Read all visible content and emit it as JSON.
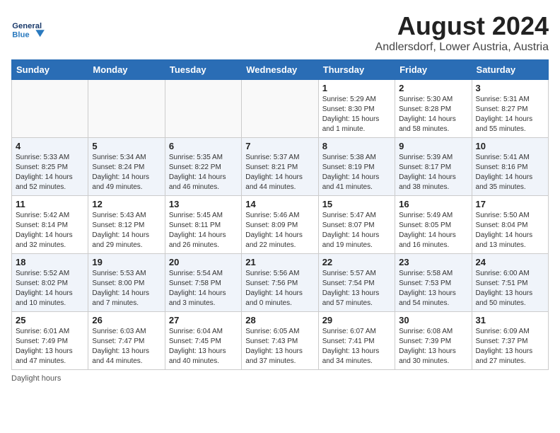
{
  "header": {
    "logo_general": "General",
    "logo_blue": "Blue",
    "month_title": "August 2024",
    "location": "Andlersdorf, Lower Austria, Austria"
  },
  "weekdays": [
    "Sunday",
    "Monday",
    "Tuesday",
    "Wednesday",
    "Thursday",
    "Friday",
    "Saturday"
  ],
  "weeks": [
    [
      {
        "day": "",
        "info": ""
      },
      {
        "day": "",
        "info": ""
      },
      {
        "day": "",
        "info": ""
      },
      {
        "day": "",
        "info": ""
      },
      {
        "day": "1",
        "info": "Sunrise: 5:29 AM\nSunset: 8:30 PM\nDaylight: 15 hours\nand 1 minute."
      },
      {
        "day": "2",
        "info": "Sunrise: 5:30 AM\nSunset: 8:28 PM\nDaylight: 14 hours\nand 58 minutes."
      },
      {
        "day": "3",
        "info": "Sunrise: 5:31 AM\nSunset: 8:27 PM\nDaylight: 14 hours\nand 55 minutes."
      }
    ],
    [
      {
        "day": "4",
        "info": "Sunrise: 5:33 AM\nSunset: 8:25 PM\nDaylight: 14 hours\nand 52 minutes."
      },
      {
        "day": "5",
        "info": "Sunrise: 5:34 AM\nSunset: 8:24 PM\nDaylight: 14 hours\nand 49 minutes."
      },
      {
        "day": "6",
        "info": "Sunrise: 5:35 AM\nSunset: 8:22 PM\nDaylight: 14 hours\nand 46 minutes."
      },
      {
        "day": "7",
        "info": "Sunrise: 5:37 AM\nSunset: 8:21 PM\nDaylight: 14 hours\nand 44 minutes."
      },
      {
        "day": "8",
        "info": "Sunrise: 5:38 AM\nSunset: 8:19 PM\nDaylight: 14 hours\nand 41 minutes."
      },
      {
        "day": "9",
        "info": "Sunrise: 5:39 AM\nSunset: 8:17 PM\nDaylight: 14 hours\nand 38 minutes."
      },
      {
        "day": "10",
        "info": "Sunrise: 5:41 AM\nSunset: 8:16 PM\nDaylight: 14 hours\nand 35 minutes."
      }
    ],
    [
      {
        "day": "11",
        "info": "Sunrise: 5:42 AM\nSunset: 8:14 PM\nDaylight: 14 hours\nand 32 minutes."
      },
      {
        "day": "12",
        "info": "Sunrise: 5:43 AM\nSunset: 8:12 PM\nDaylight: 14 hours\nand 29 minutes."
      },
      {
        "day": "13",
        "info": "Sunrise: 5:45 AM\nSunset: 8:11 PM\nDaylight: 14 hours\nand 26 minutes."
      },
      {
        "day": "14",
        "info": "Sunrise: 5:46 AM\nSunset: 8:09 PM\nDaylight: 14 hours\nand 22 minutes."
      },
      {
        "day": "15",
        "info": "Sunrise: 5:47 AM\nSunset: 8:07 PM\nDaylight: 14 hours\nand 19 minutes."
      },
      {
        "day": "16",
        "info": "Sunrise: 5:49 AM\nSunset: 8:05 PM\nDaylight: 14 hours\nand 16 minutes."
      },
      {
        "day": "17",
        "info": "Sunrise: 5:50 AM\nSunset: 8:04 PM\nDaylight: 14 hours\nand 13 minutes."
      }
    ],
    [
      {
        "day": "18",
        "info": "Sunrise: 5:52 AM\nSunset: 8:02 PM\nDaylight: 14 hours\nand 10 minutes."
      },
      {
        "day": "19",
        "info": "Sunrise: 5:53 AM\nSunset: 8:00 PM\nDaylight: 14 hours\nand 7 minutes."
      },
      {
        "day": "20",
        "info": "Sunrise: 5:54 AM\nSunset: 7:58 PM\nDaylight: 14 hours\nand 3 minutes."
      },
      {
        "day": "21",
        "info": "Sunrise: 5:56 AM\nSunset: 7:56 PM\nDaylight: 14 hours\nand 0 minutes."
      },
      {
        "day": "22",
        "info": "Sunrise: 5:57 AM\nSunset: 7:54 PM\nDaylight: 13 hours\nand 57 minutes."
      },
      {
        "day": "23",
        "info": "Sunrise: 5:58 AM\nSunset: 7:53 PM\nDaylight: 13 hours\nand 54 minutes."
      },
      {
        "day": "24",
        "info": "Sunrise: 6:00 AM\nSunset: 7:51 PM\nDaylight: 13 hours\nand 50 minutes."
      }
    ],
    [
      {
        "day": "25",
        "info": "Sunrise: 6:01 AM\nSunset: 7:49 PM\nDaylight: 13 hours\nand 47 minutes."
      },
      {
        "day": "26",
        "info": "Sunrise: 6:03 AM\nSunset: 7:47 PM\nDaylight: 13 hours\nand 44 minutes."
      },
      {
        "day": "27",
        "info": "Sunrise: 6:04 AM\nSunset: 7:45 PM\nDaylight: 13 hours\nand 40 minutes."
      },
      {
        "day": "28",
        "info": "Sunrise: 6:05 AM\nSunset: 7:43 PM\nDaylight: 13 hours\nand 37 minutes."
      },
      {
        "day": "29",
        "info": "Sunrise: 6:07 AM\nSunset: 7:41 PM\nDaylight: 13 hours\nand 34 minutes."
      },
      {
        "day": "30",
        "info": "Sunrise: 6:08 AM\nSunset: 7:39 PM\nDaylight: 13 hours\nand 30 minutes."
      },
      {
        "day": "31",
        "info": "Sunrise: 6:09 AM\nSunset: 7:37 PM\nDaylight: 13 hours\nand 27 minutes."
      }
    ]
  ],
  "footer": {
    "note": "Daylight hours"
  }
}
